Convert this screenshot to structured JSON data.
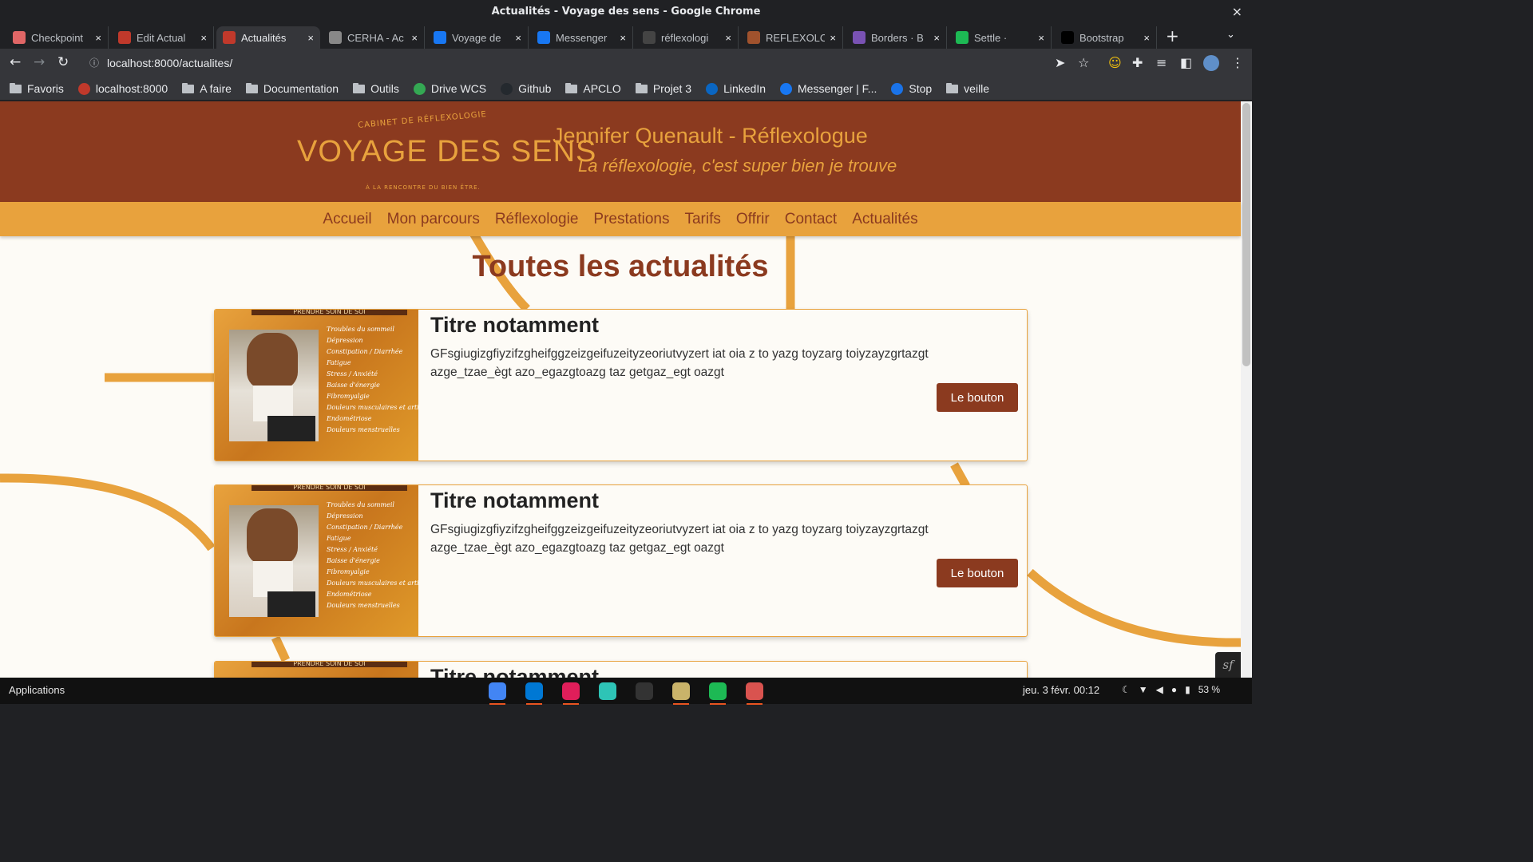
{
  "window": {
    "title": "Actualités - Voyage des sens - Google Chrome",
    "close": "×"
  },
  "tabs": [
    {
      "label": "Checkpoint",
      "icon": "checkpoint-favicon",
      "color": "#e06666"
    },
    {
      "label": "Edit Actual",
      "icon": "app-favicon",
      "color": "#c0392b"
    },
    {
      "label": "Actualités",
      "icon": "app-favicon",
      "color": "#c0392b",
      "active": true
    },
    {
      "label": "CERHA - Ac",
      "icon": "cerha-favicon",
      "color": "#888888"
    },
    {
      "label": "Voyage de",
      "icon": "facebook-favicon",
      "color": "#1877f2"
    },
    {
      "label": "Messenger",
      "icon": "facebook-favicon",
      "color": "#1877f2"
    },
    {
      "label": "réflexologi",
      "icon": "wikipedia-favicon",
      "color": "#444444"
    },
    {
      "label": "REFLEXOLO",
      "icon": "site-favicon",
      "color": "#a0522d"
    },
    {
      "label": "Borders · B",
      "icon": "bootstrap-favicon",
      "color": "#7952b3"
    },
    {
      "label": "Settle ·",
      "icon": "spotify-favicon",
      "color": "#1db954"
    },
    {
      "label": "Bootstrap",
      "icon": "symfony-favicon",
      "color": "#000000"
    }
  ],
  "tab_close": "×",
  "new_tab": "+",
  "tab_menu": "⌄",
  "toolbar": {
    "back": "←",
    "forward": "→",
    "reload": "↻",
    "url": "localhost:8000/actualites/",
    "site_info": "ⓘ"
  },
  "bookmarks": [
    {
      "label": "Favoris",
      "type": "folder"
    },
    {
      "label": "localhost:8000",
      "type": "site",
      "color": "#c0392b"
    },
    {
      "label": "A faire",
      "type": "folder"
    },
    {
      "label": "Documentation",
      "type": "folder"
    },
    {
      "label": "Outils",
      "type": "folder"
    },
    {
      "label": "Drive WCS",
      "type": "site",
      "color": "#34a853"
    },
    {
      "label": "Github",
      "type": "site",
      "color": "#24292e"
    },
    {
      "label": "APCLO",
      "type": "folder"
    },
    {
      "label": "Projet 3",
      "type": "folder"
    },
    {
      "label": "LinkedIn",
      "type": "site",
      "color": "#0a66c2"
    },
    {
      "label": "Messenger | F...",
      "type": "site",
      "color": "#1877f2"
    },
    {
      "label": "Stop",
      "type": "site",
      "color": "#1a73e8"
    },
    {
      "label": "veille",
      "type": "folder"
    }
  ],
  "site": {
    "logo_top": "CABINET DE RÉFLEXOLOGIE",
    "logo_main": "VOYAGE DES SENS",
    "logo_sub": "À LA RENCONTRE DU BIEN ÊTRE.",
    "name": "Jennifer Quenault - Réflexologue",
    "tagline": "La réflexologie, c'est super bien je trouve",
    "nav": [
      "Accueil",
      "Mon parcours",
      "Réflexologie",
      "Prestations",
      "Tarifs",
      "Offrir",
      "Contact",
      "Actualités"
    ],
    "colors": {
      "primary": "#8b3a1f",
      "accent": "#e8a23d",
      "background": "#fdfbf6"
    }
  },
  "page": {
    "title": "Toutes les actualités",
    "image_banner": "PRENDRE SOIN DE SOI",
    "image_words": [
      "Troubles du sommeil",
      "Dépression",
      "Constipation / Diarrhée",
      "Fatigue",
      "Stress / Anxiété",
      "Baisse d'énergie",
      "Fibromyalgie",
      "Douleurs musculaires et articulaires",
      "Endométriose",
      "Douleurs menstruelles"
    ],
    "articles": [
      {
        "title": "Titre notamment",
        "text": "GFsgiugizgfiyzifzgheifggzeizgeifuzeityzeoriutvyzert iat oia z to yazg toyzarg toiyzayzgrtazgt azge_tzae_ègt azo_egazgtoazg taz getgaz_egt oazgt",
        "button": "Le bouton"
      },
      {
        "title": "Titre notamment",
        "text": "GFsgiugizgfiyzifzgheifggzeizgeifuzeityzeoriutvyzert iat oia z to yazg toyzarg toiyzayzgrtazgt azge_tzae_ègt azo_egazgtoazg taz getgaz_egt oazgt",
        "button": "Le bouton"
      },
      {
        "title": "Titre notamment",
        "text": "",
        "button": ""
      }
    ]
  },
  "taskbar": {
    "applications": "Applications",
    "clock": "jeu. 3 févr.  00:12",
    "battery": "53 %",
    "dock": [
      {
        "name": "chrome",
        "color": "#4285f4",
        "running": true
      },
      {
        "name": "vscode",
        "color": "#0078d4",
        "running": true
      },
      {
        "name": "slack",
        "color": "#e01e5a",
        "running": true
      },
      {
        "name": "mail",
        "color": "#2ec4b6",
        "running": false
      },
      {
        "name": "terminal",
        "color": "#333333",
        "running": false
      },
      {
        "name": "files",
        "color": "#c9b36a",
        "running": true
      },
      {
        "name": "spotify",
        "color": "#1db954",
        "running": true
      },
      {
        "name": "text-editor",
        "color": "#d9534f",
        "running": true
      }
    ]
  }
}
